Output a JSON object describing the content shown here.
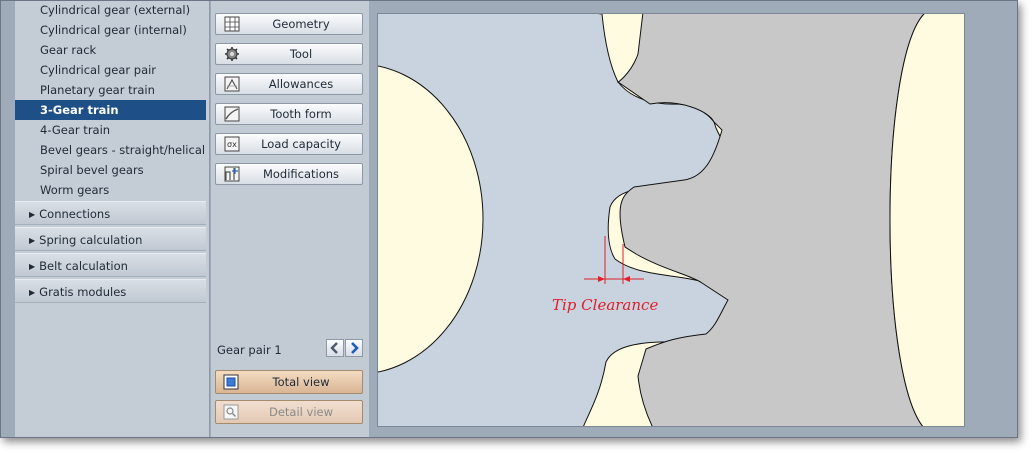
{
  "sidebar": {
    "gear_items": [
      {
        "label": "Cylindrical gear (external)",
        "active": false
      },
      {
        "label": "Cylindrical gear (internal)",
        "active": false
      },
      {
        "label": "Gear rack",
        "active": false
      },
      {
        "label": "Cylindrical gear pair",
        "active": false
      },
      {
        "label": "Planetary gear train",
        "active": false
      },
      {
        "label": "3-Gear train",
        "active": true
      },
      {
        "label": "4-Gear train",
        "active": false
      },
      {
        "label": "Bevel gears - straight/helical",
        "active": false
      },
      {
        "label": "Spiral bevel gears",
        "active": false
      },
      {
        "label": "Worm gears",
        "active": false
      }
    ],
    "sections": [
      "Connections",
      "Spring calculation",
      "Belt calculation",
      "Gratis modules"
    ]
  },
  "tools": {
    "geometry": "Geometry",
    "tool": "Tool",
    "allowances": "Allowances",
    "tooth_form": "Tooth form",
    "load_capacity": "Load capacity",
    "modifications": "Modifications"
  },
  "pair": {
    "label": "Gear pair 1"
  },
  "views": {
    "total": "Total view",
    "detail": "Detail view"
  },
  "canvas": {
    "annotation": "Tip Clearance"
  },
  "colors": {
    "selected": "#1e4f86",
    "gear_fill": "#fffbe0",
    "gear_grey": "#c8c8c8",
    "background": "#c9d3df",
    "dimension_red": "#e0202a"
  }
}
